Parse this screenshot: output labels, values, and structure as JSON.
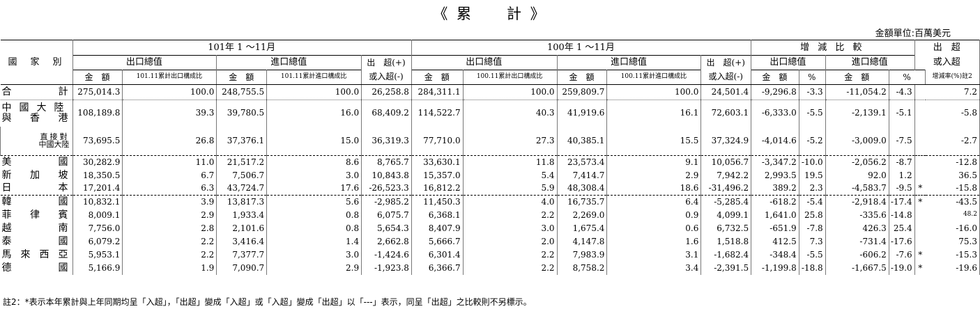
{
  "title": "《 累　　計 》",
  "unit": "金額單位:百萬美元",
  "headers": {
    "country": "國　家　別",
    "period_2012": "101年 1 ～11月",
    "period_2011": "100年 1 ～11月",
    "change": "增 減 比 較",
    "surplus_top": "出　超",
    "surplus_mid": "或入超",
    "export_total": "出口總值",
    "import_total": "進口總值",
    "surplus_plus": "出　超(+)",
    "surplus_minus": "或入超(-)",
    "amount": "金　額",
    "pct": "%",
    "share_export_2012": "101.11累計出口構成比",
    "share_import_2012": "101.11累計進口構成比",
    "share_export_2011": "100.11累計出口構成比",
    "share_import_2011": "100.11累計進口構成比",
    "rate_label": "增減率(%)註2"
  },
  "rows": [
    {
      "name": "合　　計",
      "ex12": "275,014.3",
      "exs12": "100.0",
      "im12": "248,755.5",
      "ims12": "100.0",
      "bal12": "26,258.8",
      "ex11": "284,311.1",
      "exs11": "100.0",
      "im11": "259,809.7",
      "ims11": "100.0",
      "bal11": "24,501.4",
      "dex": "-9,296.8",
      "dexp": "-3.3",
      "dim": "-11,054.2",
      "dimp": "-4.3",
      "mark": "",
      "rate": "7.2"
    },
    {
      "name": "中國大陸",
      "name2": "與　香　港",
      "ex12": "108,189.8",
      "exs12": "39.3",
      "im12": "39,780.5",
      "ims12": "16.0",
      "bal12": "68,409.2",
      "ex11": "114,522.7",
      "exs11": "40.3",
      "im11": "41,919.6",
      "ims11": "16.1",
      "bal11": "72,603.1",
      "dex": "-6,333.0",
      "dexp": "-5.5",
      "dim": "-2,139.1",
      "dimp": "-5.1",
      "mark": "",
      "rate": "-5.8"
    },
    {
      "name": "直接對",
      "name2": "中國大陸",
      "ex12": "73,695.5",
      "exs12": "26.8",
      "im12": "37,376.1",
      "ims12": "15.0",
      "bal12": "36,319.3",
      "ex11": "77,710.0",
      "exs11": "27.3",
      "im11": "40,385.1",
      "ims11": "15.5",
      "bal11": "37,324.9",
      "dex": "-4,014.6",
      "dexp": "-5.2",
      "dim": "-3,009.0",
      "dimp": "-7.5",
      "mark": "",
      "rate": "-2.7"
    },
    {
      "name": "美　　國",
      "ex12": "30,282.9",
      "exs12": "11.0",
      "im12": "21,517.2",
      "ims12": "8.6",
      "bal12": "8,765.7",
      "ex11": "33,630.1",
      "exs11": "11.8",
      "im11": "23,573.4",
      "ims11": "9.1",
      "bal11": "10,056.7",
      "dex": "-3,347.2",
      "dexp": "-10.0",
      "dim": "-2,056.2",
      "dimp": "-8.7",
      "mark": "",
      "rate": "-12.8"
    },
    {
      "name": "新　加　坡",
      "ex12": "18,350.5",
      "exs12": "6.7",
      "im12": "7,506.7",
      "ims12": "3.0",
      "bal12": "10,843.8",
      "ex11": "15,357.0",
      "exs11": "5.4",
      "im11": "7,414.7",
      "ims11": "2.9",
      "bal11": "7,942.2",
      "dex": "2,993.5",
      "dexp": "19.5",
      "dim": "92.0",
      "dimp": "1.2",
      "mark": "",
      "rate": "36.5"
    },
    {
      "name": "日　　本",
      "ex12": "17,201.4",
      "exs12": "6.3",
      "im12": "43,724.7",
      "ims12": "17.6",
      "bal12": "-26,523.3",
      "ex11": "16,812.2",
      "exs11": "5.9",
      "im11": "48,308.4",
      "ims11": "18.6",
      "bal11": "-31,496.2",
      "dex": "389.2",
      "dexp": "2.3",
      "dim": "-4,583.7",
      "dimp": "-9.5",
      "mark": "*",
      "rate": "-15.8"
    },
    {
      "name": "韓　　國",
      "ex12": "10,832.1",
      "exs12": "3.9",
      "im12": "13,817.3",
      "ims12": "5.6",
      "bal12": "-2,985.2",
      "ex11": "11,450.3",
      "exs11": "4.0",
      "im11": "16,735.7",
      "ims11": "6.4",
      "bal11": "-5,285.4",
      "dex": "-618.2",
      "dexp": "-5.4",
      "dim": "-2,918.4",
      "dimp": "-17.4",
      "mark": "*",
      "rate": "-43.5"
    },
    {
      "name": "菲　律　賓",
      "ex12": "8,009.1",
      "exs12": "2.9",
      "im12": "1,933.4",
      "ims12": "0.8",
      "bal12": "6,075.7",
      "ex11": "6,368.1",
      "exs11": "2.2",
      "im11": "2,269.0",
      "ims11": "0.9",
      "bal11": "4,099.1",
      "dex": "1,641.0",
      "dexp": "25.8",
      "dim": "-335.6",
      "dimp": "-14.8",
      "mark": "",
      "rate": "48.2"
    },
    {
      "name": "越　　南",
      "ex12": "7,756.0",
      "exs12": "2.8",
      "im12": "2,101.6",
      "ims12": "0.8",
      "bal12": "5,654.3",
      "ex11": "8,407.9",
      "exs11": "3.0",
      "im11": "1,675.4",
      "ims11": "0.6",
      "bal11": "6,732.5",
      "dex": "-651.9",
      "dexp": "-7.8",
      "dim": "426.3",
      "dimp": "25.4",
      "mark": "",
      "rate": "-16.0"
    },
    {
      "name": "泰　　國",
      "ex12": "6,079.2",
      "exs12": "2.2",
      "im12": "3,416.4",
      "ims12": "1.4",
      "bal12": "2,662.8",
      "ex11": "5,666.7",
      "exs11": "2.0",
      "im11": "4,147.8",
      "ims11": "1.6",
      "bal11": "1,518.8",
      "dex": "412.5",
      "dexp": "7.3",
      "dim": "-731.4",
      "dimp": "-17.6",
      "mark": "",
      "rate": "75.3"
    },
    {
      "name": "馬 來 西 亞",
      "ex12": "5,953.1",
      "exs12": "2.2",
      "im12": "7,377.7",
      "ims12": "3.0",
      "bal12": "-1,424.6",
      "ex11": "6,301.4",
      "exs11": "2.2",
      "im11": "7,983.9",
      "ims11": "3.1",
      "bal11": "-1,682.4",
      "dex": "-348.4",
      "dexp": "-5.5",
      "dim": "-606.2",
      "dimp": "-7.6",
      "mark": "*",
      "rate": "-15.3"
    },
    {
      "name": "德　　國",
      "ex12": "5,166.9",
      "exs12": "1.9",
      "im12": "7,090.7",
      "ims12": "2.9",
      "bal12": "-1,923.8",
      "ex11": "6,366.7",
      "exs11": "2.2",
      "im11": "8,758.2",
      "ims11": "3.4",
      "bal11": "-2,391.5",
      "dex": "-1,199.8",
      "dexp": "-18.8",
      "dim": "-1,667.5",
      "dimp": "-19.0",
      "mark": "*",
      "rate": "-19.6"
    }
  ],
  "note": "註2：*表示本年累計與上年同期均呈「入超」，「出超」變成「入超」或「入超」變成「出超」以「---」表示，同呈「出超」之比較則不另標示。"
}
